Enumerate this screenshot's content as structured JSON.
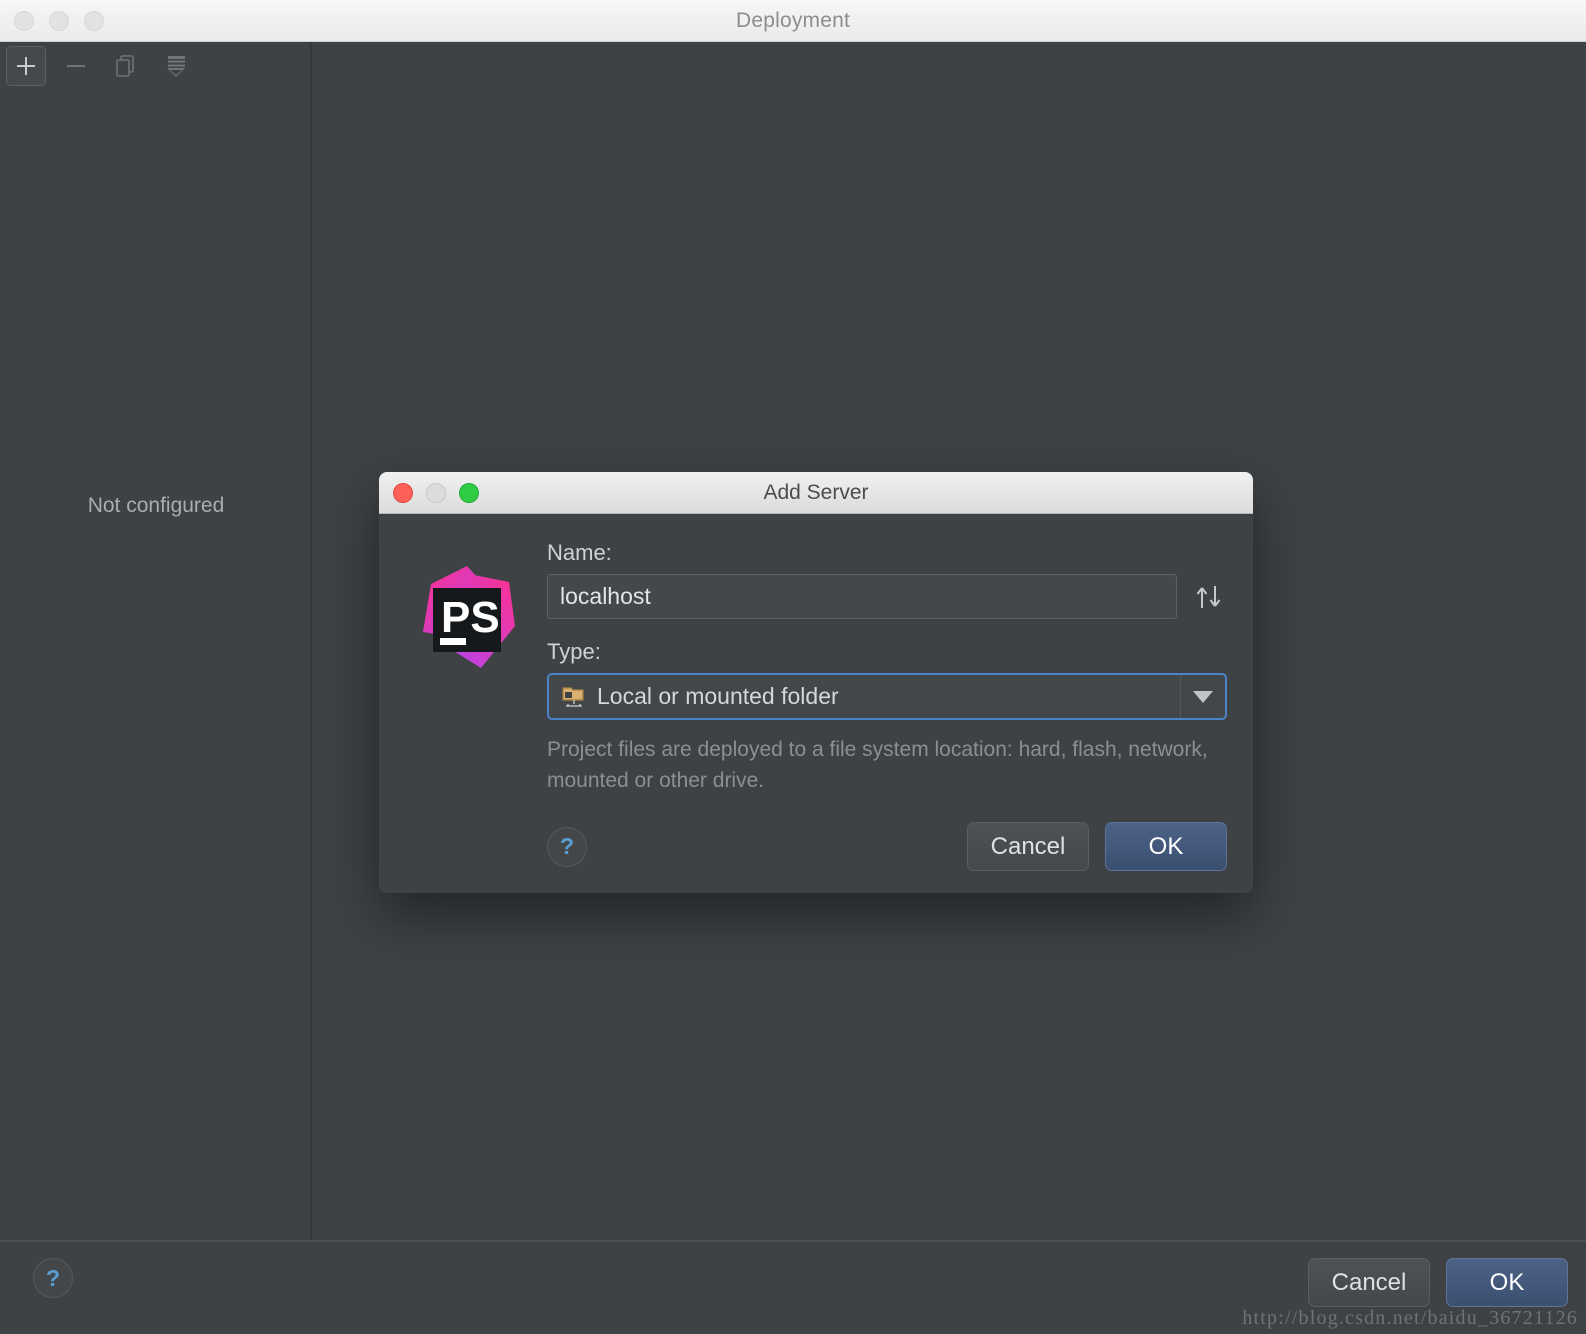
{
  "window": {
    "title": "Deployment",
    "traffic_lights": [
      "close",
      "minimize",
      "zoom"
    ],
    "toolbar": {
      "add_label": "+",
      "remove_label": "—",
      "copy_icon": "copy-icon",
      "import_icon": "import-paths-icon"
    },
    "left_pane": {
      "empty_state": "Not configured"
    },
    "footer": {
      "help_label": "?",
      "cancel_label": "Cancel",
      "ok_label": "OK"
    },
    "watermark": "http://blog.csdn.net/baidu_36721126"
  },
  "dialog": {
    "title": "Add Server",
    "traffic_lights": [
      "close",
      "minimize",
      "zoom"
    ],
    "logo": {
      "icon": "phpstorm-logo",
      "text": "PS"
    },
    "name": {
      "label": "Name:",
      "value": "localhost",
      "placeholder": "localhost",
      "sort_icon": "sort-up-down-icon"
    },
    "type": {
      "label": "Type:",
      "selected": "Local or mounted folder",
      "icon": "local-folder-icon",
      "arrow_icon": "chevron-down-icon",
      "options": [
        "Local or mounted folder"
      ]
    },
    "description": "Project files are deployed to a file system location: hard, flash, network, mounted or other drive.",
    "help_label": "?",
    "cancel_label": "Cancel",
    "ok_label": "OK"
  },
  "colors": {
    "background": "#3e4245",
    "titlebar": "#f2f1f1",
    "accent_blue": "#4b83c8",
    "primary_button": "#44598099",
    "text_primary": "#d5d8da",
    "text_muted": "#8b8f92",
    "traffic_red": "#fc6058",
    "traffic_green": "#2ecb43",
    "logo_pink": "#ff318c",
    "logo_purple": "#b345f1"
  }
}
